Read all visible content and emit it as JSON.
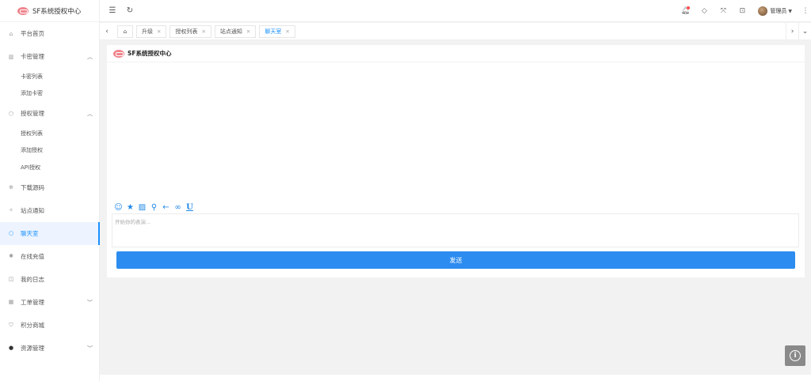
{
  "app": {
    "title": "SF系统授权中心"
  },
  "sidebar": {
    "items": [
      {
        "label": "平台首页",
        "icon": "home-icon"
      },
      {
        "label": "卡密管理",
        "icon": "card-icon",
        "expanded": true,
        "children": [
          "卡密列表",
          "添加卡密"
        ]
      },
      {
        "label": "授权管理",
        "icon": "shield-icon",
        "expanded": true,
        "children": [
          "授权列表",
          "添加授权",
          "API授权"
        ]
      },
      {
        "label": "下载源码",
        "icon": "download-icon"
      },
      {
        "label": "站点通知",
        "icon": "notice-icon"
      },
      {
        "label": "聊天室",
        "icon": "chat-icon",
        "active": true
      },
      {
        "label": "在线充值",
        "icon": "recharge-icon"
      },
      {
        "label": "我的日志",
        "icon": "log-icon"
      },
      {
        "label": "工单管理",
        "icon": "ticket-icon",
        "collapsed": true
      },
      {
        "label": "积分商城",
        "icon": "cart-icon"
      },
      {
        "label": "资源管理",
        "icon": "resource-icon",
        "collapsed": true
      }
    ]
  },
  "header": {
    "user_name": "管理员"
  },
  "tabs": [
    {
      "label": "升级"
    },
    {
      "label": "授权列表"
    },
    {
      "label": "站点通知"
    },
    {
      "label": "聊天室",
      "active": true
    }
  ],
  "chat": {
    "title": "SF系统授权中心",
    "placeholder": "开始你的表演...",
    "send_label": "发送"
  },
  "colors": {
    "accent": "#1890ff",
    "send_button": "#2d8cf0",
    "logo": "#f0838c"
  }
}
